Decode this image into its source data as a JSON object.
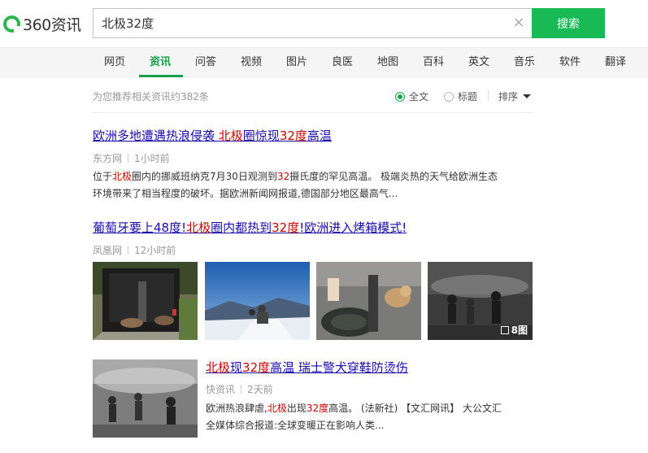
{
  "logo": {
    "text": "360资讯"
  },
  "search": {
    "value": "北极32度",
    "button_label": "搜索",
    "clear_glyph": "×"
  },
  "nav": {
    "items": [
      {
        "label": "网页"
      },
      {
        "label": "资讯"
      },
      {
        "label": "问答"
      },
      {
        "label": "视频"
      },
      {
        "label": "图片"
      },
      {
        "label": "良医"
      },
      {
        "label": "地图"
      },
      {
        "label": "百科"
      },
      {
        "label": "英文"
      },
      {
        "label": "音乐"
      },
      {
        "label": "软件"
      },
      {
        "label": "翻译"
      }
    ],
    "active_index": 1
  },
  "results_info": {
    "count_text": "为您推荐相关资讯约382条",
    "filter_fulltext": "全文",
    "filter_title": "标题",
    "sort_label": "排序"
  },
  "results": [
    {
      "title_parts": [
        "欧洲多地遭遇热浪侵袭 ",
        "北极",
        "圈惊现",
        "32度",
        "高温"
      ],
      "source": "东方网",
      "time": "1小时前",
      "snippet_line1_parts": [
        "位于",
        "北极",
        "圈内的挪威班纳克7月30日观测到",
        "32",
        "摄氏度的罕见高温。 极端炎热的天气给欧洲生态"
      ],
      "snippet_line2": "环境带来了相当程度的破坏。据欧洲新闻网报道,德国部分地区最高气..."
    },
    {
      "title_parts": [
        "葡萄牙要上48度!",
        "北极",
        "圈内都热到",
        "32度",
        "!欧洲进入烤箱模式!"
      ],
      "source": "凤凰网",
      "time": "12小时前",
      "image_count_label": "8图"
    },
    {
      "title_parts": [
        "北极",
        "现",
        "32度",
        "高温 瑞士警犬穿鞋防烫伤"
      ],
      "source": "快资讯",
      "time": "2天前",
      "snippet_line1_parts": [
        "欧洲热浪肆虐,",
        "北极",
        "出现",
        "32度",
        "高温。 (法新社) 【文汇网讯】 大公文汇"
      ],
      "snippet_line2": "全媒体综合报道:全球变暖正在影响人类..."
    }
  ],
  "colors": {
    "accent": "#19b955",
    "link": "#1a0dab",
    "highlight": "#cc0000"
  },
  "icons": [
    "clear-icon",
    "radio-icon",
    "caret-down-icon",
    "gallery-icon"
  ]
}
